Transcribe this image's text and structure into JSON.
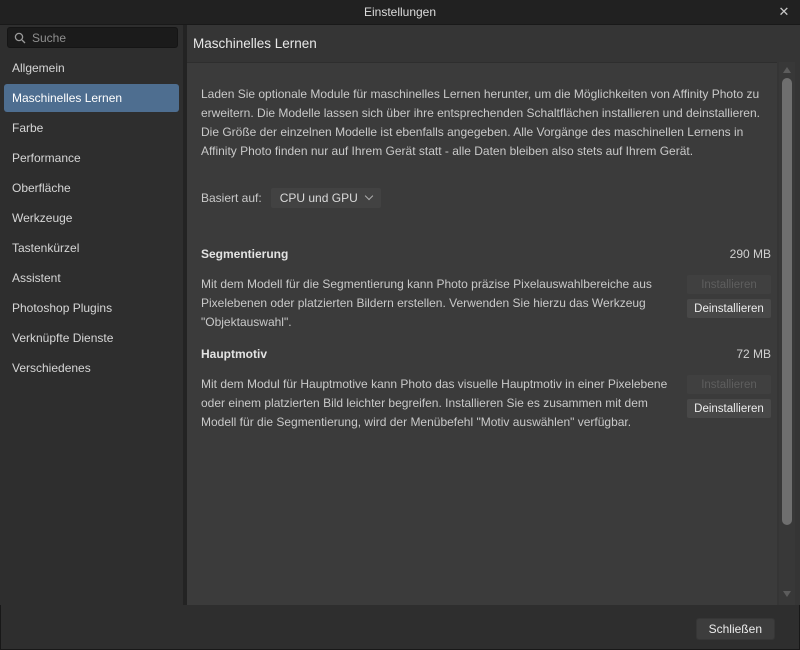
{
  "window": {
    "title": "Einstellungen",
    "close_glyph": "✕"
  },
  "sidebar": {
    "search_placeholder": "Suche",
    "items": [
      {
        "label": "Allgemein"
      },
      {
        "label": "Maschinelles Lernen",
        "selected": true
      },
      {
        "label": "Farbe"
      },
      {
        "label": "Performance"
      },
      {
        "label": "Oberfläche"
      },
      {
        "label": "Werkzeuge"
      },
      {
        "label": "Tastenkürzel"
      },
      {
        "label": "Assistent"
      },
      {
        "label": "Photoshop Plugins"
      },
      {
        "label": "Verknüpfte Dienste"
      },
      {
        "label": "Verschiedenes"
      }
    ]
  },
  "main": {
    "heading": "Maschinelles Lernen",
    "intro": "Laden Sie optionale Module für maschinelles Lernen herunter, um die Möglichkeiten von Affinity Photo zu erweitern. Die Modelle lassen sich über ihre entsprechenden Schaltflächen installieren und deinstallieren. Die Größe der einzelnen Modelle ist ebenfalls angegeben. Alle Vorgänge des maschinellen Lernens in Affinity Photo finden nur auf Ihrem Gerät statt - alle Daten bleiben also stets auf Ihrem Gerät.",
    "based_on_label": "Basiert auf:",
    "based_on_value": "CPU und GPU",
    "sections": [
      {
        "title": "Segmentierung",
        "size": "290 MB",
        "description": "Mit dem Modell für die Segmentierung kann Photo präzise Pixelauswahlbereiche aus Pixelebenen oder platzierten Bildern erstellen. Verwenden Sie hierzu das Werkzeug \"Objektauswahl\".",
        "install_label": "Installieren",
        "uninstall_label": "Deinstallieren"
      },
      {
        "title": "Hauptmotiv",
        "size": "72 MB",
        "description": "Mit dem Modul für Hauptmotive kann Photo das visuelle Hauptmotiv in einer Pixelebene oder einem platzierten Bild leichter begreifen. Installieren Sie es zusammen mit dem Modell für die Segmentierung, wird der Menübefehl \"Motiv auswählen\" verfügbar.",
        "install_label": "Installieren",
        "uninstall_label": "Deinstallieren"
      }
    ]
  },
  "footer": {
    "close_label": "Schließen"
  },
  "colors": {
    "selection_accent": "#4e6e90",
    "panel_bg": "#353535",
    "box_bg": "#3b3b3b",
    "sidebar_bg": "#2e2e2e",
    "titlebar_bg": "#212121"
  }
}
